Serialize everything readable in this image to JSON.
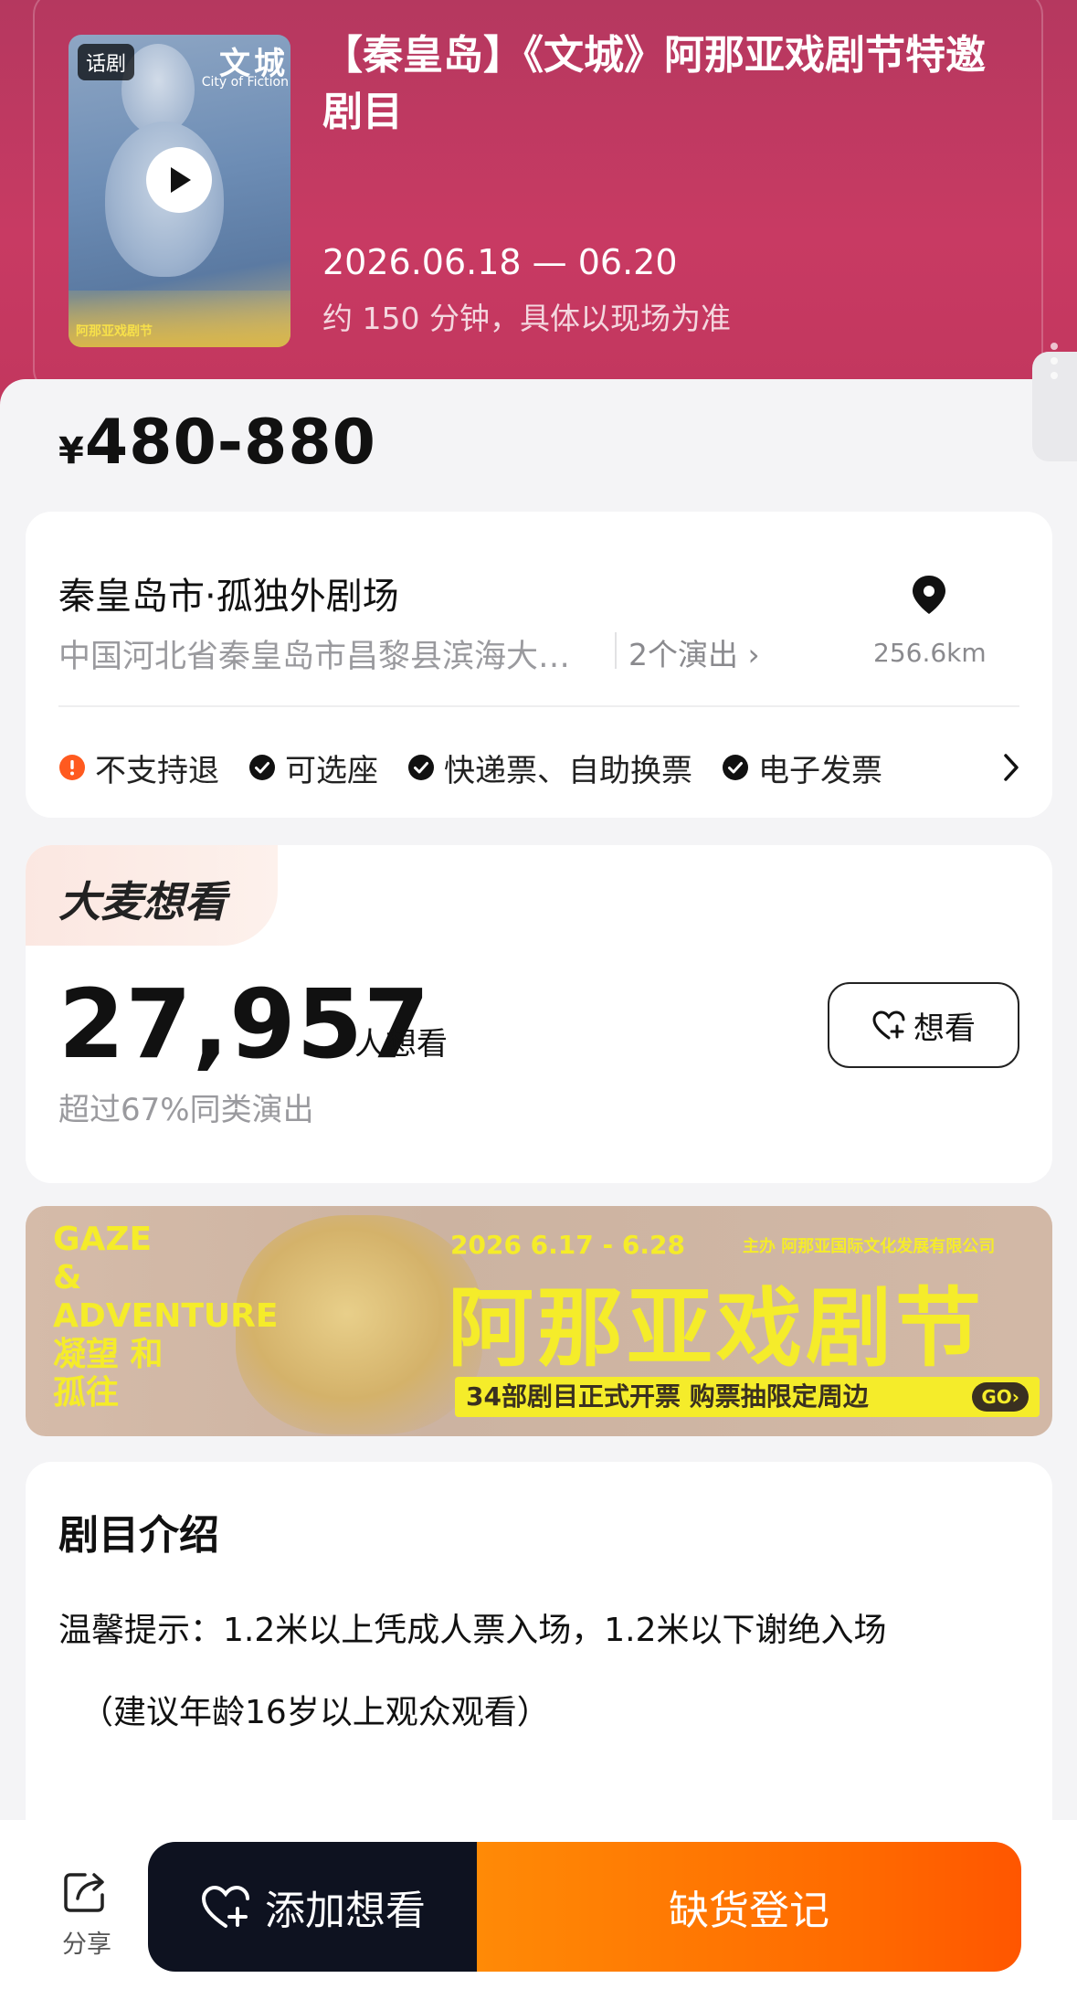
{
  "hero": {
    "poster_tag": "话剧",
    "poster_title": "文城",
    "poster_subtitle": "City of Fiction",
    "poster_logo": "阿那亚戏剧节",
    "title": "【秦皇岛】《文城》阿那亚戏剧节特邀剧目",
    "date": "2026.06.18 — 06.20",
    "duration": "约 150 分钟，具体以现场为准"
  },
  "price": {
    "currency": "¥",
    "range": "480-880"
  },
  "venue": {
    "name": "秦皇岛市·孤独外剧场",
    "address": "中国河北省秦皇岛市昌黎县滨海大道阿那亚",
    "shows_label": "2个演出 ›",
    "distance": "256.6km",
    "policies": [
      {
        "label": "不支持退",
        "icon": "alert-icon",
        "color": "#ff5a1f"
      },
      {
        "label": "可选座",
        "icon": "check-icon",
        "color": "#111111"
      },
      {
        "label": "快递票、自助换票",
        "icon": "check-icon",
        "color": "#111111"
      },
      {
        "label": "电子发票",
        "icon": "check-icon",
        "color": "#111111"
      }
    ]
  },
  "want": {
    "brand": "大麦想看",
    "count": "27,957",
    "unit": "人想看",
    "rank": "超过67%同类演出",
    "button": "想看"
  },
  "banner": {
    "en_line1": "GAZE",
    "en_line2": "&",
    "en_line3": "ADVENTURE",
    "cn_line1": "凝望 和",
    "cn_line2": "孤往",
    "date": "2026 6.17 - 6.28",
    "host": "主办 阿那亚国际文化发展有限公司",
    "title": "阿那亚戏剧节",
    "subtitle": "34部剧目正式开票 购票抽限定周边",
    "go": "GO›"
  },
  "intro": {
    "title": "剧目介绍",
    "tip": "温馨提示：1.2米以上凭成人票入场，1.2米以下谢绝入场",
    "age": "（建议年龄16岁以上观众观看）"
  },
  "bottom": {
    "share_label": "分享",
    "add_want_label": "添加想看",
    "register_label": "缺货登记"
  },
  "colors": {
    "hero": "#c83a63",
    "accent": "#ff6a00",
    "dark": "#0e1220",
    "banner_yellow": "#f5ec2a"
  }
}
